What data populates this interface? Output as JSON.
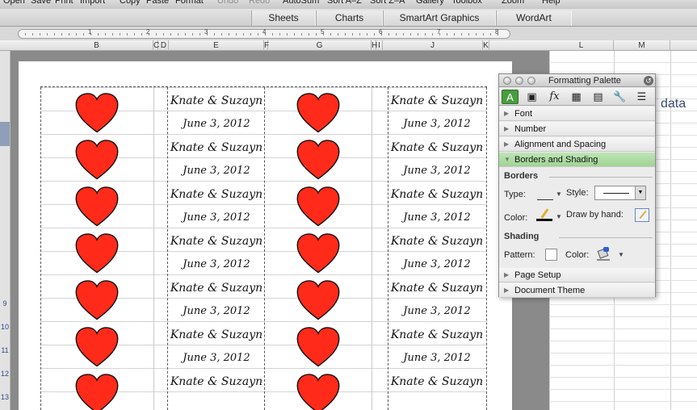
{
  "toolbar": {
    "items": [
      "Open",
      "Save",
      "Print",
      "Import",
      "Copy",
      "Paste",
      "Format",
      "Undo",
      "Redo",
      "AutoSum",
      "Sort A–Z",
      "Sort Z–A",
      "Gallery",
      "Toolbox",
      "Zoom",
      "Help"
    ]
  },
  "ribbon": {
    "tabs": [
      "Sheets",
      "Charts",
      "SmartArt Graphics",
      "WordArt"
    ]
  },
  "ruler": {
    "numbers": [
      "1",
      "2",
      "3",
      "4",
      "5",
      "6",
      "7",
      "8"
    ]
  },
  "columns": {
    "left": [
      "B",
      "C",
      "D",
      "E",
      "F",
      "G",
      "H",
      "I",
      "J",
      "K"
    ],
    "right": [
      "L",
      "M"
    ]
  },
  "rows": {
    "numbers": [
      "9",
      "10",
      "11",
      "12",
      "13",
      "14"
    ]
  },
  "labels": {
    "name": "Knate & Suzayn",
    "date": "June 3, 2012",
    "heart_color": "#ff2a1a"
  },
  "right_area": {
    "visible_text": "data"
  },
  "palette": {
    "title": "Formatting Palette",
    "icons": [
      "text-format-icon",
      "insert-object-icon",
      "fx-icon",
      "image-icon",
      "book-icon",
      "wrench-icon",
      "document-icon"
    ],
    "sections": {
      "font": "Font",
      "number": "Number",
      "alignment": "Alignment and Spacing",
      "borders_shading": "Borders and Shading",
      "page_setup": "Page Setup",
      "document_theme": "Document Theme"
    },
    "borders": {
      "header": "Borders",
      "type_label": "Type:",
      "style_label": "Style:",
      "color_label": "Color:",
      "draw_label": "Draw by hand:"
    },
    "shading": {
      "header": "Shading",
      "pattern_label": "Pattern:",
      "color_label": "Color:"
    }
  },
  "colors": {
    "accent_green": "#4a9d3f",
    "section_open": "#a6d69b"
  }
}
